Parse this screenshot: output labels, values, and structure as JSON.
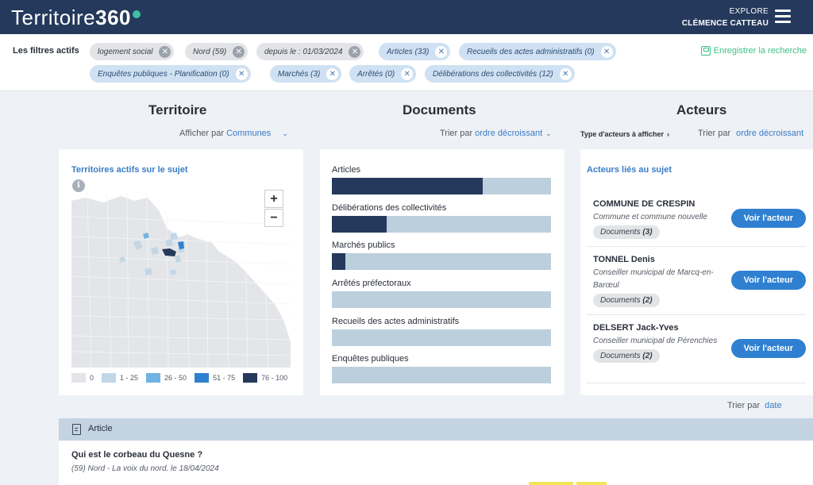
{
  "header": {
    "logo_text": "Territoire",
    "logo_bold": "360",
    "explore_label": "EXPLORE",
    "user_name": "CLÉMENCE CATTEAU"
  },
  "filters": {
    "label": "Les filtres actifs",
    "chips": [
      {
        "label": "logement social",
        "style": "grey"
      },
      {
        "label": "Nord (59)",
        "style": "grey"
      },
      {
        "label": "depuis le : 01/03/2024",
        "style": "grey"
      },
      {
        "label": "Articles (33)",
        "style": "blue"
      },
      {
        "label": "Recueils des actes administratifs (0)",
        "style": "blue"
      },
      {
        "label": "Enquêtes publiques - Planification (0)",
        "style": "blue"
      },
      {
        "label": "Marchés (3)",
        "style": "blue"
      },
      {
        "label": "Arrêtés (0)",
        "style": "blue"
      },
      {
        "label": "Délibérations des collectivités (12)",
        "style": "blue"
      }
    ],
    "save_label": "Enregistrer la recherche"
  },
  "territoire": {
    "title": "Territoire",
    "display_label": "Afficher par",
    "display_value": "Communes",
    "card_title": "Territoires actifs sur le sujet",
    "legend": [
      {
        "label": "0",
        "color": "#e3e5e8"
      },
      {
        "label": "1 - 25",
        "color": "#c3d6e6"
      },
      {
        "label": "26 - 50",
        "color": "#6fb3e3"
      },
      {
        "label": "51 - 75",
        "color": "#2f80d0"
      },
      {
        "label": "76 - 100",
        "color": "#24395b"
      }
    ]
  },
  "documents": {
    "title": "Documents",
    "sort_label": "Trier par",
    "sort_value": "ordre décroissant",
    "items": [
      {
        "label": "Articles",
        "fill": 0.69
      },
      {
        "label": "Délibérations des collectivités",
        "fill": 0.25
      },
      {
        "label": "Marchés publics",
        "fill": 0.06
      },
      {
        "label": "Arrêtés préfectoraux",
        "fill": 0
      },
      {
        "label": "Recueils des actes administratifs",
        "fill": 0
      },
      {
        "label": "Enquêtes publiques",
        "fill": 0
      }
    ]
  },
  "acteurs": {
    "title": "Acteurs",
    "type_label": "Type d'acteurs à afficher",
    "sort_label": "Trier par",
    "sort_value": "ordre décroissant",
    "card_title": "Acteurs liés au sujet",
    "button_label": "Voir l'acteur",
    "docs_label": "Documents",
    "items": [
      {
        "name": "COMMUNE DE CRESPIN",
        "role": "Commune et commune nouvelle",
        "docs": "(3)"
      },
      {
        "name": "TONNEL Denis",
        "role": "Conseiller municipal de Marcq-en-Barœul",
        "docs": "(2)"
      },
      {
        "name": "DELSERT Jack-Yves",
        "role": "Conseiller municipal de Pérenchies",
        "docs": "(2)"
      }
    ]
  },
  "results": {
    "sort_label": "Trier par",
    "sort_value": "date",
    "type": "Article",
    "title": "Qui est le corbeau du Quesne ?",
    "meta": "(59) Nord - La voix du nord. le 18/04/2024"
  }
}
